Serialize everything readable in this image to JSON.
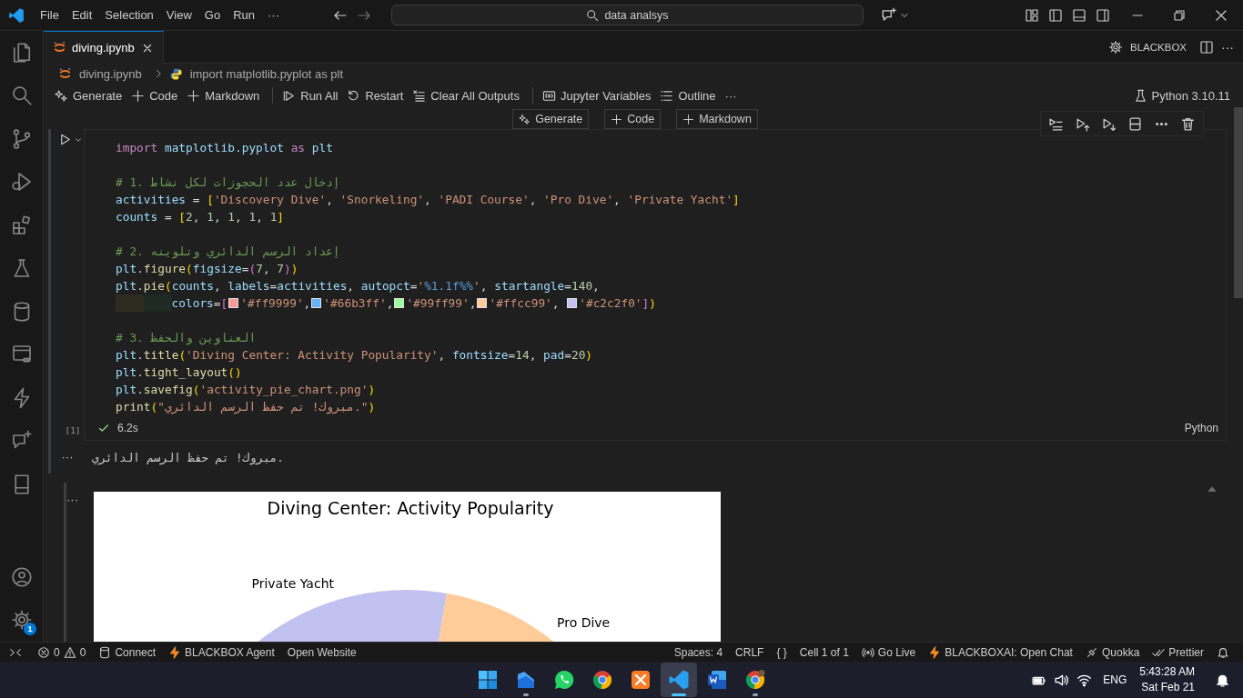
{
  "title_bar": {
    "menu": [
      "File",
      "Edit",
      "Selection",
      "View",
      "Go",
      "Run",
      "···"
    ],
    "search": "data analsys"
  },
  "activity_bar": {
    "top": [
      {
        "kind": "files"
      },
      {
        "kind": "search"
      },
      {
        "kind": "source-control"
      },
      {
        "kind": "run-debug"
      },
      {
        "kind": "extensions"
      },
      {
        "kind": "testing"
      },
      {
        "kind": "database"
      },
      {
        "kind": "remote-explorer"
      },
      {
        "kind": "bolt"
      },
      {
        "kind": "chat"
      },
      {
        "kind": "notebook"
      }
    ],
    "bottom": [
      {
        "kind": "account"
      },
      {
        "kind": "settings",
        "badge": "1"
      }
    ]
  },
  "tabs": [
    {
      "label": "diving.ipynb",
      "selected": true
    }
  ],
  "editor_actions": {
    "label": "BLACKBOX",
    "more": "···"
  },
  "breadcrumb": [
    {
      "kind": "notebook",
      "label": "diving.ipynb"
    },
    {
      "kind": "python",
      "label": "import matplotlib.pyplot as plt"
    }
  ],
  "notebook_toolbar": {
    "groups": [
      [
        {
          "kind": "generate",
          "label": "Generate"
        },
        {
          "kind": "add",
          "label": "Code"
        },
        {
          "kind": "add",
          "label": "Markdown"
        }
      ],
      [
        {
          "kind": "run-all",
          "label": "Run All"
        },
        {
          "kind": "restart",
          "label": "Restart"
        },
        {
          "kind": "clear",
          "label": "Clear All Outputs"
        }
      ],
      [
        {
          "kind": "variables",
          "label": "Jupyter Variables"
        },
        {
          "kind": "outline",
          "label": "Outline"
        },
        {
          "kind": "more",
          "label": "···"
        }
      ]
    ],
    "kernel": "Python 3.10.11"
  },
  "insert_buttons": [
    {
      "kind": "generate",
      "label": "Generate"
    },
    {
      "kind": "add",
      "label": "Code"
    },
    {
      "kind": "add",
      "label": "Markdown"
    }
  ],
  "cell_toolbar": [
    {
      "kind": "run-by-line"
    },
    {
      "kind": "run-above"
    },
    {
      "kind": "run-below"
    },
    {
      "kind": "split"
    },
    {
      "kind": "more"
    },
    {
      "kind": "delete"
    }
  ],
  "cell": {
    "count": "[1]",
    "succeeded": true,
    "duration": "6.2s",
    "language": "Python",
    "lines": [
      {
        "kind": "code",
        "tokens": [
          {
            "kind": "kw",
            "text": "import "
          },
          {
            "kind": "var",
            "text": "matplotlib.pyplot "
          },
          {
            "kind": "kw",
            "text": "as "
          },
          {
            "kind": "var",
            "text": "plt"
          }
        ]
      },
      {
        "kind": "blank"
      },
      {
        "kind": "code",
        "tokens": [
          {
            "kind": "cmt",
            "text": "# 1. إدخال عدد الحجوزات لكل نشاط"
          }
        ]
      },
      {
        "kind": "code",
        "tokens": [
          {
            "kind": "var",
            "text": "activities"
          },
          {
            "kind": "op",
            "text": " = "
          },
          {
            "kind": "b1",
            "text": "["
          },
          {
            "kind": "str",
            "text": "'Discovery Dive'"
          },
          {
            "kind": "op",
            "text": ", "
          },
          {
            "kind": "str",
            "text": "'Snorkeling'"
          },
          {
            "kind": "op",
            "text": ", "
          },
          {
            "kind": "str",
            "text": "'PADI Course'"
          },
          {
            "kind": "op",
            "text": ", "
          },
          {
            "kind": "str",
            "text": "'Pro Dive'"
          },
          {
            "kind": "op",
            "text": ", "
          },
          {
            "kind": "str",
            "text": "'Private Yacht'"
          },
          {
            "kind": "b1",
            "text": "]"
          }
        ]
      },
      {
        "kind": "code",
        "tokens": [
          {
            "kind": "var",
            "text": "counts"
          },
          {
            "kind": "op",
            "text": " = "
          },
          {
            "kind": "b1",
            "text": "["
          },
          {
            "kind": "num",
            "text": "2"
          },
          {
            "kind": "op",
            "text": ", "
          },
          {
            "kind": "num",
            "text": "1"
          },
          {
            "kind": "op",
            "text": ", "
          },
          {
            "kind": "num",
            "text": "1"
          },
          {
            "kind": "op",
            "text": ", "
          },
          {
            "kind": "num",
            "text": "1"
          },
          {
            "kind": "op",
            "text": ", "
          },
          {
            "kind": "num",
            "text": "1"
          },
          {
            "kind": "b1",
            "text": "]"
          }
        ]
      },
      {
        "kind": "blank"
      },
      {
        "kind": "code",
        "tokens": [
          {
            "kind": "cmt",
            "text": "# 2. إعداد الرسم الدائري وتلوينه"
          }
        ]
      },
      {
        "kind": "code",
        "tokens": [
          {
            "kind": "var",
            "text": "plt"
          },
          {
            "kind": "op",
            "text": "."
          },
          {
            "kind": "fn",
            "text": "figure"
          },
          {
            "kind": "b1",
            "text": "("
          },
          {
            "kind": "var",
            "text": "figsize"
          },
          {
            "kind": "op",
            "text": "="
          },
          {
            "kind": "b2",
            "text": "("
          },
          {
            "kind": "num",
            "text": "7"
          },
          {
            "kind": "op",
            "text": ", "
          },
          {
            "kind": "num",
            "text": "7"
          },
          {
            "kind": "b2",
            "text": ")"
          },
          {
            "kind": "b1",
            "text": ")"
          }
        ]
      },
      {
        "kind": "code",
        "tokens": [
          {
            "kind": "var",
            "text": "plt"
          },
          {
            "kind": "op",
            "text": "."
          },
          {
            "kind": "fn",
            "text": "pie"
          },
          {
            "kind": "b1",
            "text": "("
          },
          {
            "kind": "var",
            "text": "counts"
          },
          {
            "kind": "op",
            "text": ", "
          },
          {
            "kind": "var",
            "text": "labels"
          },
          {
            "kind": "op",
            "text": "="
          },
          {
            "kind": "var",
            "text": "activities"
          },
          {
            "kind": "op",
            "text": ", "
          },
          {
            "kind": "var",
            "text": "autopct"
          },
          {
            "kind": "op",
            "text": "="
          },
          {
            "kind": "str",
            "text": "'"
          },
          {
            "kind": "fmt",
            "text": "%1.1f%%"
          },
          {
            "kind": "str",
            "text": "'"
          },
          {
            "kind": "op",
            "text": ", "
          },
          {
            "kind": "var",
            "text": "startangle"
          },
          {
            "kind": "op",
            "text": "="
          },
          {
            "kind": "num",
            "text": "140"
          },
          {
            "kind": "op",
            "text": ","
          }
        ]
      },
      {
        "kind": "code",
        "tokens": [
          {
            "kind": "indent",
            "color": "#2c2d1f"
          },
          {
            "kind": "indent",
            "color": "#1e2a23"
          },
          {
            "kind": "var",
            "text": "colors"
          },
          {
            "kind": "op",
            "text": "="
          },
          {
            "kind": "b2",
            "text": "["
          },
          {
            "kind": "swatch",
            "color": "#ff9999"
          },
          {
            "kind": "str",
            "text": "'#ff9999'"
          },
          {
            "kind": "op",
            "text": ","
          },
          {
            "kind": "swatch",
            "color": "#66b3ff"
          },
          {
            "kind": "str",
            "text": "'#66b3ff'"
          },
          {
            "kind": "op",
            "text": ","
          },
          {
            "kind": "swatch",
            "color": "#99ff99"
          },
          {
            "kind": "str",
            "text": "'#99ff99'"
          },
          {
            "kind": "op",
            "text": ","
          },
          {
            "kind": "swatch",
            "color": "#ffcc99"
          },
          {
            "kind": "str",
            "text": "'#ffcc99'"
          },
          {
            "kind": "op",
            "text": ", "
          },
          {
            "kind": "swatch",
            "color": "#c2c2f0"
          },
          {
            "kind": "str",
            "text": "'#c2c2f0'"
          },
          {
            "kind": "b2",
            "text": "]"
          },
          {
            "kind": "b1",
            "text": ")"
          }
        ]
      },
      {
        "kind": "blank"
      },
      {
        "kind": "code",
        "tokens": [
          {
            "kind": "cmt",
            "text": "# 3. العناوين والحفظ"
          }
        ]
      },
      {
        "kind": "code",
        "tokens": [
          {
            "kind": "var",
            "text": "plt"
          },
          {
            "kind": "op",
            "text": "."
          },
          {
            "kind": "fn",
            "text": "title"
          },
          {
            "kind": "b1",
            "text": "("
          },
          {
            "kind": "str",
            "text": "'Diving Center: Activity Popularity'"
          },
          {
            "kind": "op",
            "text": ", "
          },
          {
            "kind": "var",
            "text": "fontsize"
          },
          {
            "kind": "op",
            "text": "="
          },
          {
            "kind": "num",
            "text": "14"
          },
          {
            "kind": "op",
            "text": ", "
          },
          {
            "kind": "var",
            "text": "pad"
          },
          {
            "kind": "op",
            "text": "="
          },
          {
            "kind": "num",
            "text": "20"
          },
          {
            "kind": "b1",
            "text": ")"
          }
        ]
      },
      {
        "kind": "code",
        "tokens": [
          {
            "kind": "var",
            "text": "plt"
          },
          {
            "kind": "op",
            "text": "."
          },
          {
            "kind": "fn",
            "text": "tight_layout"
          },
          {
            "kind": "b1",
            "text": "()"
          }
        ]
      },
      {
        "kind": "code",
        "tokens": [
          {
            "kind": "var",
            "text": "plt"
          },
          {
            "kind": "op",
            "text": "."
          },
          {
            "kind": "fn",
            "text": "savefig"
          },
          {
            "kind": "b1",
            "text": "("
          },
          {
            "kind": "str",
            "text": "'activity_pie_chart.png'"
          },
          {
            "kind": "b1",
            "text": ")"
          }
        ]
      },
      {
        "kind": "code",
        "tokens": [
          {
            "kind": "fn",
            "text": "print"
          },
          {
            "kind": "b1",
            "text": "("
          },
          {
            "kind": "str",
            "text": "\"مبروك! تم حفظ الرسم الدائري.\""
          },
          {
            "kind": "b1",
            "text": ")"
          }
        ]
      }
    ]
  },
  "outputs": [
    {
      "kind": "text",
      "menu": "···",
      "text": "مبروك! تم حفظ الرسم الدائري."
    },
    {
      "kind": "figure",
      "menu": "···",
      "title": "Diving Center: Activity Popularity",
      "slices": [
        {
          "label": "Private Yacht",
          "color": "#c2c2f0"
        },
        {
          "label": "Pro Dive",
          "color": "#ffcc99"
        }
      ]
    }
  ],
  "status_bar": {
    "left": [
      {
        "kind": "remote"
      },
      {
        "kind": "problems",
        "errors": "0",
        "warnings": "0"
      },
      {
        "kind": "database",
        "label": "Connect"
      },
      {
        "kind": "bolt",
        "label": "BLACKBOX Agent"
      },
      {
        "kind": "plain",
        "label": "Open Website"
      }
    ],
    "right": [
      {
        "kind": "plain",
        "label": "Spaces: 4"
      },
      {
        "kind": "plain",
        "label": "CRLF"
      },
      {
        "kind": "plain",
        "label": "{ }"
      },
      {
        "kind": "plain",
        "label": "Cell 1 of 1"
      },
      {
        "kind": "broadcast",
        "label": "Go Live"
      },
      {
        "kind": "bolt",
        "label": "BLACKBOXAI: Open Chat"
      },
      {
        "kind": "quokka",
        "label": "Quokka"
      },
      {
        "kind": "prettier",
        "label": "Prettier"
      },
      {
        "kind": "bell"
      }
    ]
  },
  "taskbar": {
    "apps": [
      {
        "kind": "start",
        "running": false,
        "selected": false
      },
      {
        "kind": "files",
        "running": true,
        "selected": false
      },
      {
        "kind": "whatsapp",
        "running": false,
        "selected": false
      },
      {
        "kind": "chrome",
        "running": false,
        "selected": false
      },
      {
        "kind": "xampp",
        "running": false,
        "selected": false
      },
      {
        "kind": "vscode",
        "running": true,
        "selected": true
      },
      {
        "kind": "word",
        "running": false,
        "selected": false
      },
      {
        "kind": "chrome-profile",
        "running": true,
        "selected": false
      }
    ],
    "language": "ENG",
    "time": "5:43:28 AM",
    "date": "Sat Feb 21"
  }
}
